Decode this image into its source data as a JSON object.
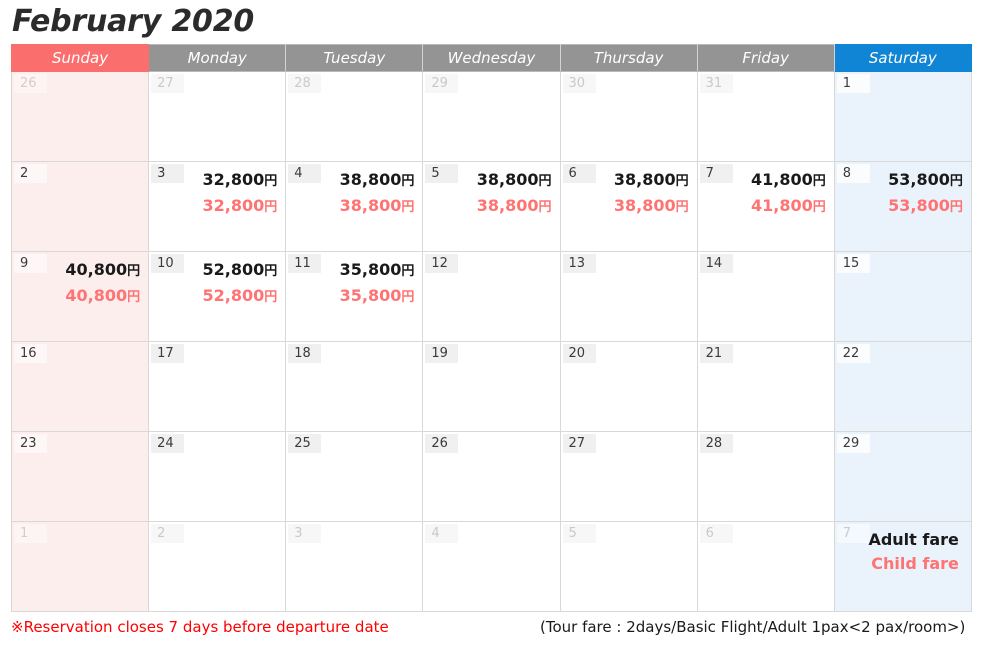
{
  "title": "February 2020",
  "weekday_headers": [
    {
      "label": "Sunday",
      "kind": "sun"
    },
    {
      "label": "Monday",
      "kind": "week"
    },
    {
      "label": "Tuesday",
      "kind": "week"
    },
    {
      "label": "Wednesday",
      "kind": "week"
    },
    {
      "label": "Thursday",
      "kind": "week"
    },
    {
      "label": "Friday",
      "kind": "week"
    },
    {
      "label": "Saturday",
      "kind": "sat"
    }
  ],
  "colors": {
    "sunday_header_bg": "#fa6e6e",
    "saturday_header_bg": "#1185d5",
    "weekday_header_bg": "#949494",
    "sunday_cell_bg": "#fdeeee",
    "saturday_cell_bg": "#eaf2fb",
    "adult_fare_text": "#1a1a1a",
    "child_fare_text": "#ff7373",
    "footer_note_text": "#ff0000",
    "grid_line": "#d8d8d8"
  },
  "legend": {
    "adult_label": "Adult fare",
    "child_label": "Child fare"
  },
  "footer": {
    "note": "※Reservation closes 7 days before departure date",
    "fare_conditions": "(Tour fare : 2days/Basic Flight/Adult 1pax<2 pax/room>)"
  },
  "weeks": [
    [
      {
        "day": "26",
        "out": true,
        "adult": "",
        "child": ""
      },
      {
        "day": "27",
        "out": true,
        "adult": "",
        "child": ""
      },
      {
        "day": "28",
        "out": true,
        "adult": "",
        "child": ""
      },
      {
        "day": "29",
        "out": true,
        "adult": "",
        "child": ""
      },
      {
        "day": "30",
        "out": true,
        "adult": "",
        "child": ""
      },
      {
        "day": "31",
        "out": true,
        "adult": "",
        "child": ""
      },
      {
        "day": "1",
        "out": false,
        "adult": "",
        "child": ""
      }
    ],
    [
      {
        "day": "2",
        "out": false,
        "adult": "",
        "child": ""
      },
      {
        "day": "3",
        "out": false,
        "adult": "32,800円",
        "child": "32,800円"
      },
      {
        "day": "4",
        "out": false,
        "adult": "38,800円",
        "child": "38,800円"
      },
      {
        "day": "5",
        "out": false,
        "adult": "38,800円",
        "child": "38,800円"
      },
      {
        "day": "6",
        "out": false,
        "adult": "38,800円",
        "child": "38,800円"
      },
      {
        "day": "7",
        "out": false,
        "adult": "41,800円",
        "child": "41,800円"
      },
      {
        "day": "8",
        "out": false,
        "adult": "53,800円",
        "child": "53,800円"
      }
    ],
    [
      {
        "day": "9",
        "out": false,
        "adult": "40,800円",
        "child": "40,800円"
      },
      {
        "day": "10",
        "out": false,
        "adult": "52,800円",
        "child": "52,800円"
      },
      {
        "day": "11",
        "out": false,
        "adult": "35,800円",
        "child": "35,800円"
      },
      {
        "day": "12",
        "out": false,
        "adult": "",
        "child": ""
      },
      {
        "day": "13",
        "out": false,
        "adult": "",
        "child": ""
      },
      {
        "day": "14",
        "out": false,
        "adult": "",
        "child": ""
      },
      {
        "day": "15",
        "out": false,
        "adult": "",
        "child": ""
      }
    ],
    [
      {
        "day": "16",
        "out": false,
        "adult": "",
        "child": ""
      },
      {
        "day": "17",
        "out": false,
        "adult": "",
        "child": ""
      },
      {
        "day": "18",
        "out": false,
        "adult": "",
        "child": ""
      },
      {
        "day": "19",
        "out": false,
        "adult": "",
        "child": ""
      },
      {
        "day": "20",
        "out": false,
        "adult": "",
        "child": ""
      },
      {
        "day": "21",
        "out": false,
        "adult": "",
        "child": ""
      },
      {
        "day": "22",
        "out": false,
        "adult": "",
        "child": ""
      }
    ],
    [
      {
        "day": "23",
        "out": false,
        "adult": "",
        "child": ""
      },
      {
        "day": "24",
        "out": false,
        "adult": "",
        "child": ""
      },
      {
        "day": "25",
        "out": false,
        "adult": "",
        "child": ""
      },
      {
        "day": "26",
        "out": false,
        "adult": "",
        "child": ""
      },
      {
        "day": "27",
        "out": false,
        "adult": "",
        "child": ""
      },
      {
        "day": "28",
        "out": false,
        "adult": "",
        "child": ""
      },
      {
        "day": "29",
        "out": false,
        "adult": "",
        "child": ""
      }
    ],
    [
      {
        "day": "1",
        "out": true,
        "adult": "",
        "child": ""
      },
      {
        "day": "2",
        "out": true,
        "adult": "",
        "child": ""
      },
      {
        "day": "3",
        "out": true,
        "adult": "",
        "child": ""
      },
      {
        "day": "4",
        "out": true,
        "adult": "",
        "child": ""
      },
      {
        "day": "5",
        "out": true,
        "adult": "",
        "child": ""
      },
      {
        "day": "6",
        "out": true,
        "adult": "",
        "child": ""
      },
      {
        "day": "7",
        "out": true,
        "adult": "",
        "child": "",
        "legend": true
      }
    ]
  ]
}
